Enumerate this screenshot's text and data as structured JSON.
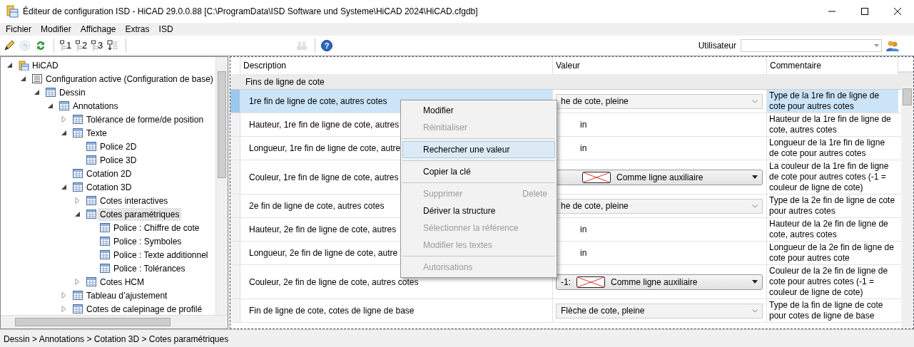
{
  "window": {
    "title": "Éditeur de configuration ISD  - HiCAD 29.0.0.88 [C:\\ProgramData\\ISD Software und Systeme\\HiCAD 2024\\HiCAD.cfgdb]"
  },
  "menu": [
    "Fichier",
    "Modifier",
    "Affichage",
    "Extras",
    "ISD"
  ],
  "toolbar": [
    {
      "kind": "pencil",
      "disabled": false
    },
    {
      "kind": "undo",
      "disabled": true
    },
    {
      "kind": "refresh",
      "disabled": false
    },
    {
      "kind": "sep"
    },
    {
      "kind": "level",
      "label": "1",
      "disabled": false
    },
    {
      "kind": "level",
      "label": "2",
      "disabled": false
    },
    {
      "kind": "level",
      "label": "3",
      "disabled": false
    },
    {
      "kind": "expand",
      "disabled": false
    },
    {
      "kind": "sep"
    },
    {
      "kind": "gap"
    },
    {
      "kind": "binoculars",
      "disabled": true
    },
    {
      "kind": "sep"
    },
    {
      "kind": "help",
      "label": "?",
      "disabled": false
    }
  ],
  "user": {
    "label": "Utilisateur"
  },
  "tree": [
    {
      "label": "HiCAD",
      "kind": "root",
      "expanded": true,
      "selected": false,
      "children": [
        {
          "label": "Configuration active (Configuration de base)",
          "kind": "config",
          "expanded": true,
          "selected": false,
          "children": [
            {
              "label": "Dessin",
              "kind": "table",
              "expanded": true,
              "selected": false,
              "children": [
                {
                  "label": "Annotations",
                  "kind": "table",
                  "expanded": true,
                  "selected": false,
                  "children": [
                    {
                      "label": "Tolérance de forme/de position",
                      "kind": "table",
                      "expanded": false,
                      "selected": false
                    },
                    {
                      "label": "Texte",
                      "kind": "table",
                      "expanded": true,
                      "selected": false,
                      "children": [
                        {
                          "label": "Police 2D",
                          "kind": "table",
                          "selected": false
                        },
                        {
                          "label": "Police 3D",
                          "kind": "table",
                          "selected": false
                        }
                      ]
                    },
                    {
                      "label": "Cotation 2D",
                      "kind": "table",
                      "selected": false
                    },
                    {
                      "label": "Cotation 3D",
                      "kind": "table",
                      "expanded": true,
                      "selected": false,
                      "children": [
                        {
                          "label": "Cotes interactives",
                          "kind": "table",
                          "expanded": false,
                          "selected": false
                        },
                        {
                          "label": "Cotes paramétriques",
                          "kind": "table",
                          "expanded": true,
                          "selected": true,
                          "children": [
                            {
                              "label": "Police : Chiffre de cote",
                              "kind": "table",
                              "selected": false
                            },
                            {
                              "label": "Police : Symboles",
                              "kind": "table",
                              "selected": false
                            },
                            {
                              "label": "Police : Texte additionnel",
                              "kind": "table",
                              "selected": false
                            },
                            {
                              "label": "Police : Tolérances",
                              "kind": "table",
                              "selected": false
                            }
                          ]
                        },
                        {
                          "label": "Cotes HCM",
                          "kind": "table",
                          "expanded": false,
                          "selected": false
                        }
                      ]
                    },
                    {
                      "label": "Tableau d’ajustement",
                      "kind": "table",
                      "expanded": false,
                      "selected": false
                    },
                    {
                      "label": "Cotes de calepinage de profilé",
                      "kind": "table",
                      "expanded": false,
                      "selected": false
                    }
                  ]
                }
              ]
            }
          ]
        }
      ]
    }
  ],
  "grid": {
    "columns": [
      "Description",
      "Valeur",
      "Commentaire"
    ],
    "group": "Fins de ligne de cote",
    "rows": [
      {
        "description": "1re fin de ligne de cote, autres cotes",
        "value": {
          "kind": "combo",
          "text": "he de cote, pleine"
        },
        "comment": "Type de la 1re fin de ligne de cote pour autres cotes",
        "selected": true
      },
      {
        "description": "Hauteur, 1re fin de ligne de cote, autres",
        "value": {
          "kind": "text",
          "text": "in"
        },
        "comment": "Hauteur de la 1re fin de ligne de cote, autres cotes",
        "selected": false
      },
      {
        "description": "Longueur, 1re fin de ligne de cote, autre",
        "value": {
          "kind": "text",
          "text": "in"
        },
        "comment": "Longueur de la 1re fin de ligne de cote pour autres cotes",
        "selected": false
      },
      {
        "description": "Couleur, 1re fin de ligne de cote, autres",
        "value": {
          "kind": "color",
          "text": "Comme ligne auxiliaire"
        },
        "comment": "La couleur de la 1re fin de ligne de cote pour autres cotes (-1 = couleur de ligne de cote)",
        "selected": false
      },
      {
        "description": "2e fin de ligne de cote, autres cotes",
        "value": {
          "kind": "combo",
          "text": "he de cote, pleine"
        },
        "comment": "Type de la 2e fin de ligne de cote pour autres cotes",
        "selected": false
      },
      {
        "description": "Hauteur, 2e fin de ligne de cote, autres",
        "value": {
          "kind": "text",
          "text": "in"
        },
        "comment": "Hauteur de la 2e fin de ligne de cote, autres cotes",
        "selected": false
      },
      {
        "description": "Longueur, 2e fin de ligne de cote, autre",
        "value": {
          "kind": "text",
          "text": "in"
        },
        "comment": "Longueur de la 2e fin de ligne de cote pour autres cote",
        "selected": false
      },
      {
        "description": "Couleur, 2e fin de ligne de cote, autres cotes",
        "value": {
          "kind": "color",
          "code": "-1:",
          "text": "Comme ligne auxiliaire"
        },
        "comment": "Couleur de la 2e fin de ligne de cote pour autres cotes (-1 = couleur de ligne de cote)",
        "selected": false
      },
      {
        "description": "Fin de ligne de cote, cotes de ligne de base",
        "value": {
          "kind": "combo",
          "text": "Flèche de cote, pleine"
        },
        "comment": "Type de la fin de ligne de cote pour cotes de ligne de base",
        "selected": false
      }
    ]
  },
  "context_menu": [
    {
      "kind": "item",
      "label": "Modifier",
      "disabled": false,
      "selected": false
    },
    {
      "kind": "item",
      "label": "Réinitialiser",
      "disabled": true,
      "selected": false
    },
    {
      "kind": "separator"
    },
    {
      "kind": "item",
      "label": "Rechercher une valeur",
      "disabled": false,
      "selected": true
    },
    {
      "kind": "separator"
    },
    {
      "kind": "item",
      "label": "Copier la clé",
      "disabled": false,
      "selected": false
    },
    {
      "kind": "separator"
    },
    {
      "kind": "item",
      "label": "Supprimer",
      "shortcut": "Delete",
      "disabled": true,
      "selected": false
    },
    {
      "kind": "item",
      "label": "Dériver la structure",
      "disabled": false,
      "selected": false
    },
    {
      "kind": "item",
      "label": "Sélectionner la référence",
      "disabled": true,
      "selected": false
    },
    {
      "kind": "item",
      "label": "Modifier les textes",
      "disabled": true,
      "selected": false
    },
    {
      "kind": "separator"
    },
    {
      "kind": "item",
      "label": "Autorisations",
      "disabled": true,
      "selected": false
    }
  ],
  "status_bar": "Dessin > Annotations > Cotation 3D > Cotes paramétriques"
}
